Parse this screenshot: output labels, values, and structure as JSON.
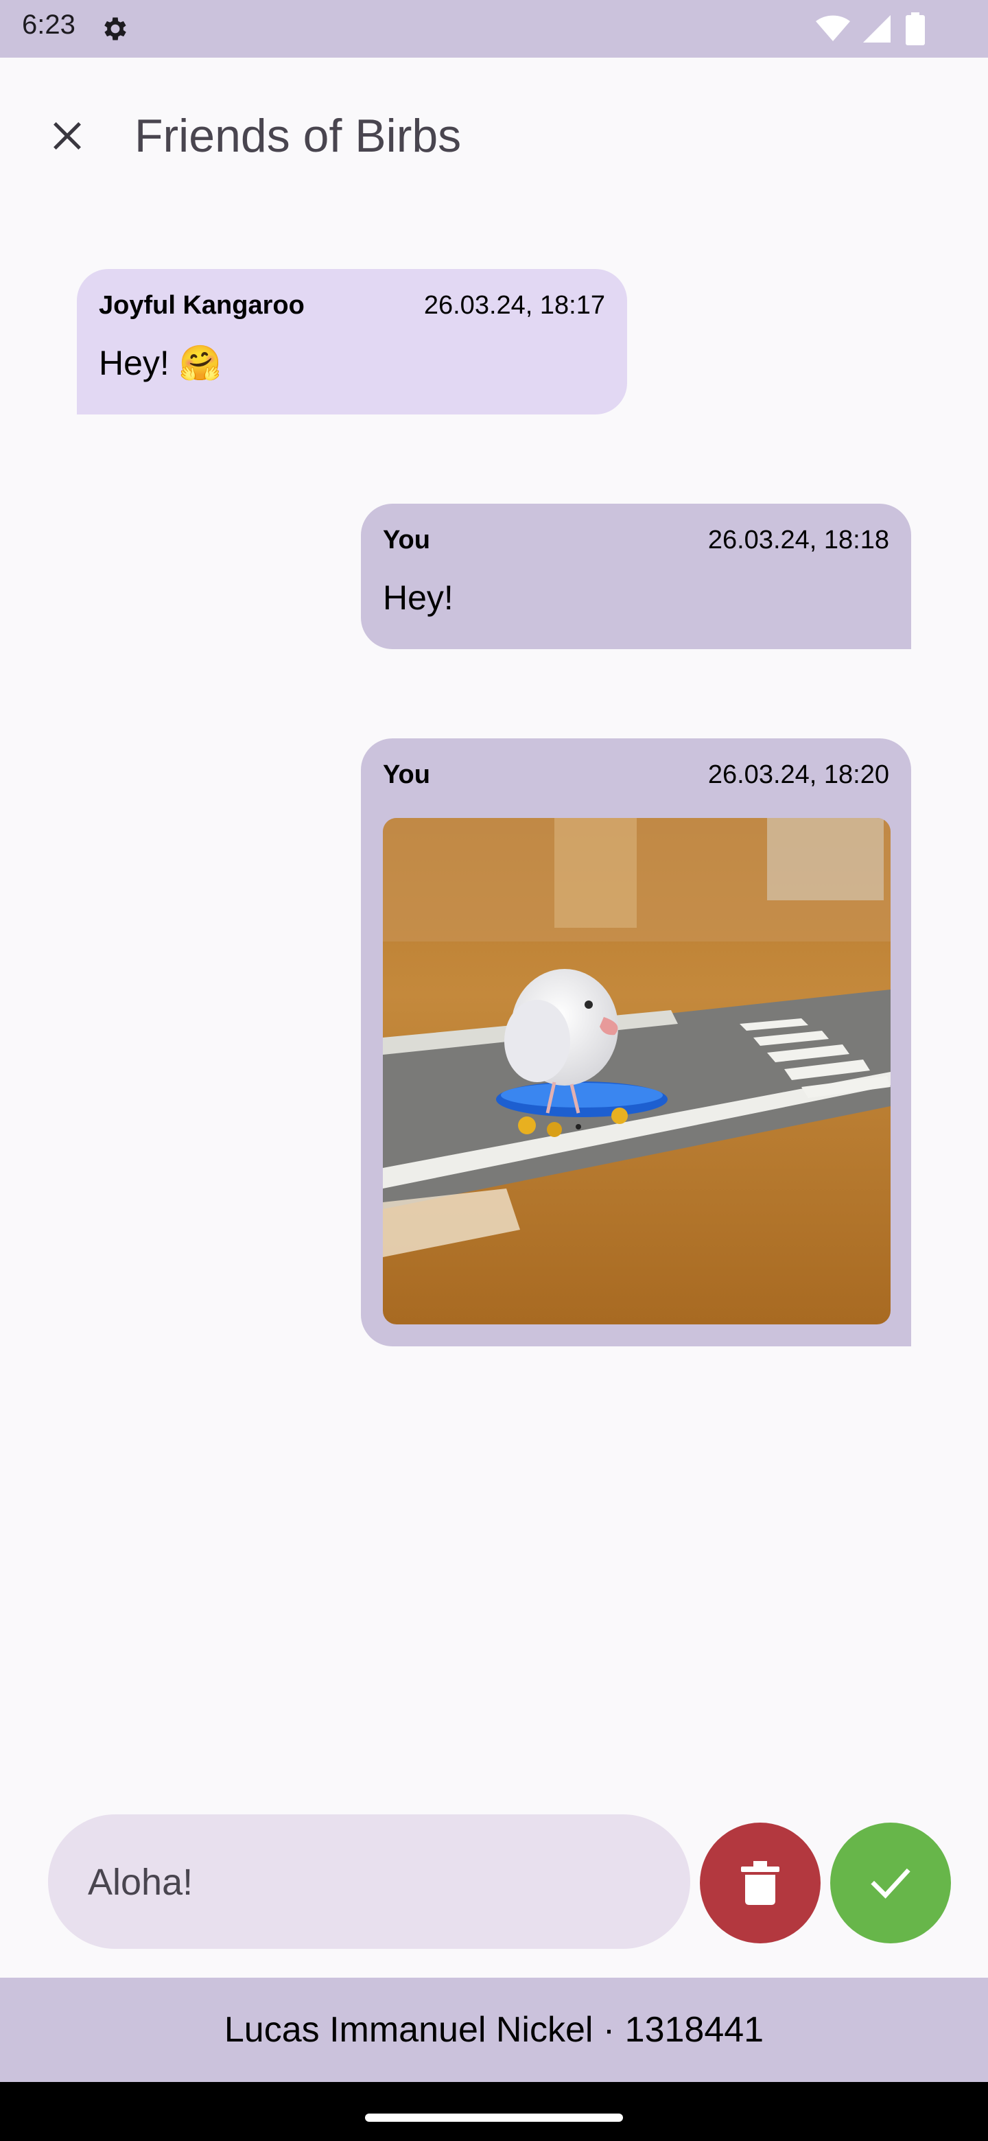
{
  "status_bar": {
    "time": "6:23",
    "icons": [
      "gear-icon",
      "wifi-icon",
      "signal-icon",
      "battery-icon"
    ]
  },
  "app_bar": {
    "close_icon": "close-icon",
    "title": "Friends of Birbs"
  },
  "messages": [
    {
      "sender": "Joyful Kangaroo",
      "timestamp": "26.03.24, 18:17",
      "text": "Hey! 🤗",
      "direction": "incoming"
    },
    {
      "sender": "You",
      "timestamp": "26.03.24, 18:18",
      "text": "Hey!",
      "direction": "outgoing"
    },
    {
      "sender": "You",
      "timestamp": "26.03.24, 18:20",
      "image": "bird-on-skateboard",
      "direction": "outgoing"
    }
  ],
  "composer": {
    "value": "Aloha!",
    "delete_icon": "trash-icon",
    "confirm_icon": "check-icon"
  },
  "footer": {
    "text": "Lucas Immanuel Nickel · 1318441"
  },
  "colors": {
    "status_bar": "#cbc2dc",
    "incoming_bubble": "#e2d8f3",
    "outgoing_bubble": "#cbc2dc",
    "composer": "#e8e0ee",
    "delete_button": "#b3383f",
    "confirm_button": "#67b64a",
    "footer": "#cbc2dc"
  }
}
